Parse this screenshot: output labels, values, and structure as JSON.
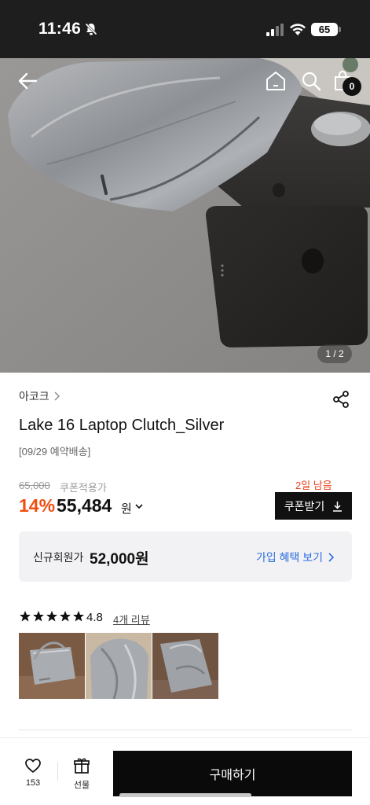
{
  "status_bar": {
    "time": "11:46",
    "battery": "65"
  },
  "hero": {
    "page_indicator": "1 / 2",
    "cart_count": "0"
  },
  "product": {
    "brand": "아코크",
    "title": "Lake 16 Laptop Clutch_Silver",
    "shipping_note": "[09/29 예약배송]"
  },
  "pricing": {
    "original_price": "65,000",
    "coupon_label": "쿠폰적용가",
    "days_left": "2일 남음",
    "discount_rate": "14%",
    "sale_price": "55,484",
    "currency_unit": "원",
    "coupon_button_label": "쿠폰받기",
    "member_label": "신규회원가",
    "member_price": "52,000원",
    "member_link_label": "가입 혜택 보기"
  },
  "reviews": {
    "rating": "4.8",
    "rating_stars": 4.8,
    "review_count_label": "4개 리뷰",
    "thumbnails": [
      "review-photo-1",
      "review-photo-2",
      "review-photo-3"
    ]
  },
  "bottom_bar": {
    "like_count": "153",
    "gift_label": "선물",
    "buy_label": "구매하기"
  },
  "colors": {
    "discount": "#f04e12",
    "days_left": "#e8431b",
    "link": "#2f6fe0",
    "button_dark": "#0a0a0a"
  }
}
